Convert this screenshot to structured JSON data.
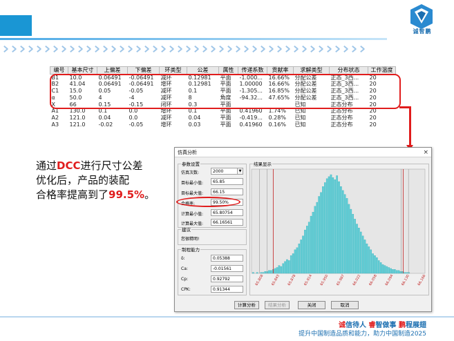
{
  "logo": {
    "text": "诚智鹏"
  },
  "table": {
    "headers": [
      "编号",
      "基本尺寸",
      "上偏差",
      "下偏差",
      "环类型",
      "公差",
      "属性",
      "传递系数",
      "贡献率",
      "求解类型",
      "分布状态",
      "工作温度"
    ],
    "rows": [
      [
        "B1",
        "10.0",
        "0.06491",
        "-0.06491",
        "减环",
        "0.12981",
        "平面",
        "-1.000...",
        "16.66%",
        "分配公差",
        "正态_3西...",
        "20"
      ],
      [
        "B2",
        "41.04",
        "0.06491",
        "-0.06491",
        "增环",
        "0.12981",
        "平面",
        "1.00000",
        "16.66%",
        "分配公差",
        "正态_3西...",
        "20"
      ],
      [
        "C1",
        "15.0",
        "0.05",
        "-0.05",
        "减环",
        "0.1",
        "平面",
        "-1.305...",
        "16.85%",
        "分配公差",
        "正态_3西...",
        "20"
      ],
      [
        "α",
        "50.0",
        "4",
        "-4",
        "减环",
        "8",
        "角度",
        "-94.32...",
        "47.65%",
        "分配公差",
        "正态_3西...",
        "20"
      ],
      [
        "X",
        "66",
        "0.15",
        "-0.15",
        "闭环",
        "0.3",
        "平面",
        "",
        "",
        "已知",
        "正态分布",
        "20"
      ],
      [
        "A1",
        "130.0",
        "0.1",
        "0.0",
        "增环",
        "0.1",
        "平面",
        "0.41960",
        "1.74%",
        "已知",
        "正态分布",
        "20"
      ],
      [
        "A2",
        "121.0",
        "0.04",
        "0.0",
        "减环",
        "0.04",
        "平面",
        "-0.419...",
        "0.28%",
        "已知",
        "正态分布",
        "20"
      ],
      [
        "A3",
        "121.0",
        "-0.02",
        "-0.05",
        "增环",
        "0.03",
        "平面",
        "0.41960",
        "0.16%",
        "已知",
        "正态分布",
        "20"
      ]
    ]
  },
  "caption": {
    "l1_a": "通过",
    "l1_red": "DCC",
    "l1_b": "进行尺寸公差",
    "l2": "优化后，产品的装配",
    "l3_a": "合格率提高到了",
    "l3_red": "99.5%",
    "l3_b": "。"
  },
  "dialog": {
    "title": "仿真分析",
    "close_glyph": "×",
    "params": {
      "legend": "参数设置",
      "sim_count_label": "仿真次数:",
      "sim_count_value": "2000",
      "target_min_label": "目标最小值:",
      "target_min_value": "65.85",
      "target_max_label": "目标最大值:",
      "target_max_value": "66.15",
      "pass_label": "合格率:",
      "pass_value": "99.50%",
      "calc_min_label": "计算最小值:",
      "calc_min_value": "65.80754",
      "calc_max_label": "计算最大值:",
      "calc_max_value": "66.16561"
    },
    "advice": {
      "legend": "建议",
      "text": "您很精明!"
    },
    "capability": {
      "legend": "制程能力",
      "delta_label": "δ:",
      "delta_value": "0.05388",
      "ca_label": "Ca:",
      "ca_value": "-0.01561",
      "cp_label": "Cp:",
      "cp_value": "0.92792",
      "cpk_label": "CPK:",
      "cpk_value": "0.91344"
    },
    "results_legend": "结果显示",
    "buttons": {
      "calc": "计算分析",
      "report": "结果分析",
      "close": "关闭",
      "cancel": "取消"
    }
  },
  "chart_data": {
    "type": "bar",
    "xlim": [
      65.8,
      66.2
    ],
    "x_ticks": [
      "65.808",
      "65.843",
      "65.878",
      "65.914",
      "65.950",
      "65.987",
      "66.022",
      "66.058",
      "66.094",
      "66.130",
      "66.166"
    ],
    "values": [
      1,
      0,
      1,
      0,
      1,
      1,
      2,
      2,
      3,
      3,
      4,
      5,
      6,
      8,
      7,
      10,
      12,
      14,
      13,
      18,
      20,
      24,
      26,
      30,
      34,
      38,
      44,
      48,
      52,
      58,
      62,
      68,
      72,
      78,
      82,
      88,
      92,
      96,
      98,
      100,
      97,
      95,
      99,
      93,
      88,
      84,
      80,
      76,
      70,
      65,
      60,
      55,
      50,
      46,
      42,
      38,
      34,
      30,
      27,
      24,
      20,
      18,
      16,
      13,
      11,
      9,
      8,
      7,
      6,
      5,
      4,
      4,
      3,
      3,
      2,
      2,
      1,
      1,
      1,
      0
    ],
    "limits": [
      65.85,
      66.15
    ],
    "bar_color": "#5ed0d8",
    "limit_color": "#c02020"
  },
  "footer": {
    "l1_a": "诚",
    "l1_b": "信待人 ",
    "l1_c": "睿",
    "l1_d": "智做事 ",
    "l1_e": "鹏",
    "l1_f": "程展翅",
    "l2": "提升中国制造品质和能力，助力中国制造2025"
  }
}
